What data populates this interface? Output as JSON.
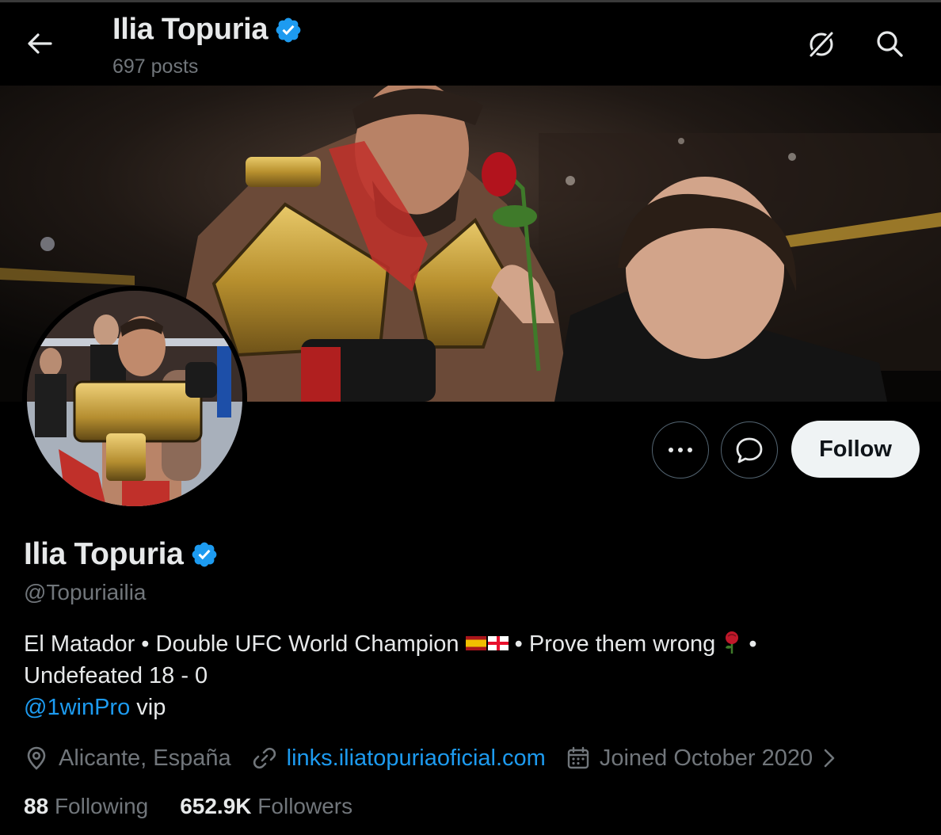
{
  "header": {
    "name": "Ilia Topuria",
    "posts": "697 posts"
  },
  "profile": {
    "name": "Ilia Topuria",
    "handle": "@Topuriailia",
    "bio_part1": "El Matador • Double UFC World Champion",
    "bio_part2": " • Prove them wrong",
    "bio_part3": " •",
    "bio_line2": "Undefeated 18 - 0",
    "bio_mention": "@1winPro",
    "bio_mention_suffix": " vip",
    "location": "Alicante, España",
    "website": "links.iliatopuriaoficial.com",
    "joined": "Joined October 2020",
    "following_count": "88",
    "following_label": "Following",
    "followers_count": "652.9K",
    "followers_label": "Followers"
  },
  "actions": {
    "follow_label": "Follow"
  },
  "icons": {
    "back": "arrow-left-icon",
    "grok": "grok-icon",
    "search": "search-icon",
    "more": "more-dots-icon",
    "message": "message-bubble-icon",
    "verified": "verified-badge-icon",
    "location": "location-pin-icon",
    "link": "link-icon",
    "calendar": "calendar-icon",
    "chevron": "chevron-right-icon",
    "rose": "rose-icon",
    "flags": [
      "spain-flag-icon",
      "georgia-flag-icon"
    ]
  },
  "colors": {
    "background": "#000000",
    "text_primary": "#e7e9ea",
    "text_secondary": "#71767b",
    "accent_link": "#1d9bf0",
    "follow_button_bg": "#eff3f4",
    "verified": "#1d9bf0"
  }
}
